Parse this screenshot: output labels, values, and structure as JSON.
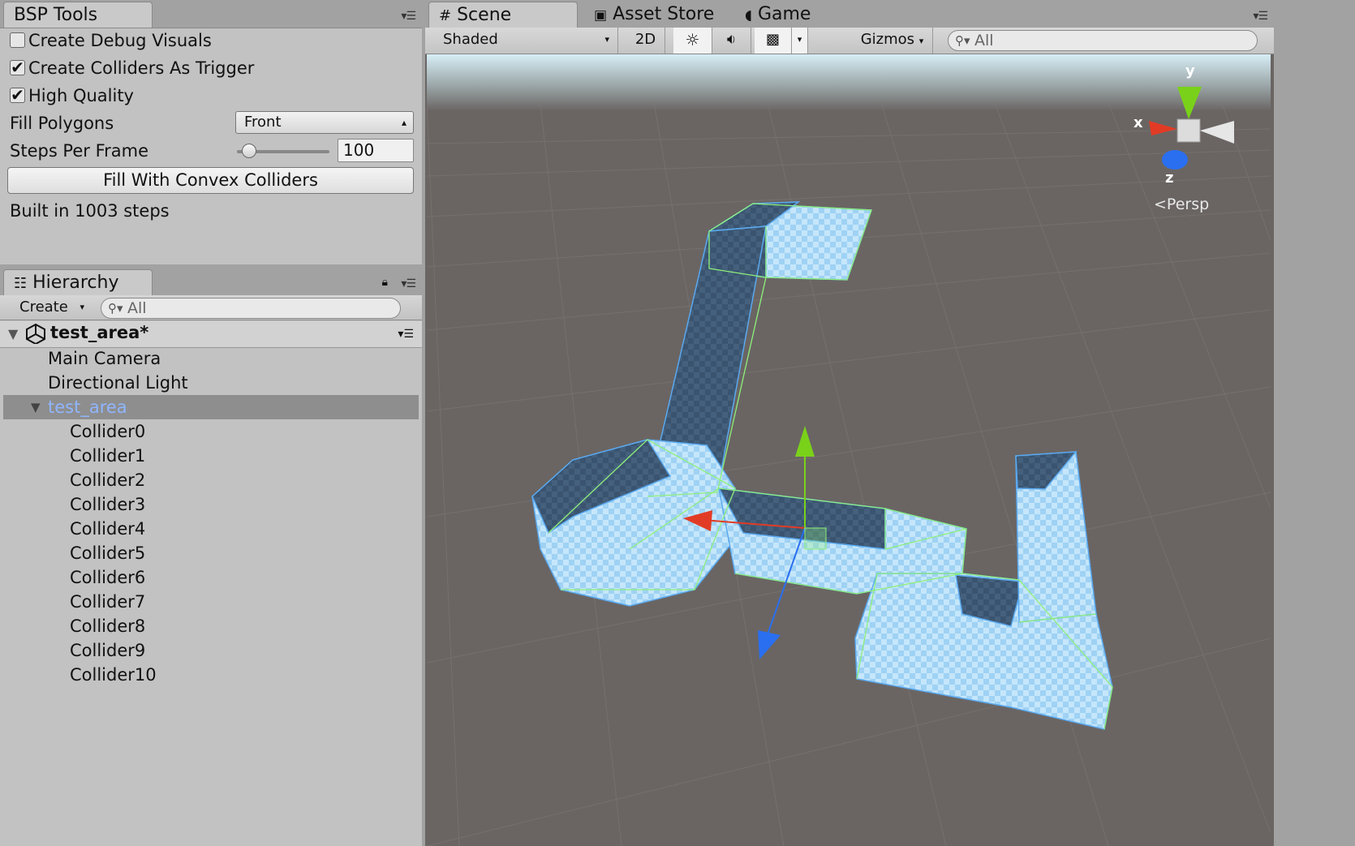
{
  "bsp_tools": {
    "tab_label": "BSP Tools",
    "create_debug_visuals": {
      "label": "Create Debug Visuals",
      "checked": false
    },
    "create_colliders_as_trigger": {
      "label": "Create Colliders As Trigger",
      "checked": true
    },
    "high_quality": {
      "label": "High Quality",
      "checked": true
    },
    "fill_polygons": {
      "label": "Fill Polygons",
      "value": "Front"
    },
    "steps_per_frame": {
      "label": "Steps Per Frame",
      "value": "100"
    },
    "fill_button_label": "Fill With Convex Colliders",
    "status": "Built in 1003 steps"
  },
  "hierarchy": {
    "tab_label": "Hierarchy",
    "create_label": "Create",
    "search_placeholder": "All",
    "scene_name": "test_area*",
    "items": [
      {
        "label": "Main Camera"
      },
      {
        "label": "Directional Light"
      },
      {
        "label": "test_area",
        "selected": true
      },
      {
        "label": "Collider0"
      },
      {
        "label": "Collider1"
      },
      {
        "label": "Collider2"
      },
      {
        "label": "Collider3"
      },
      {
        "label": "Collider4"
      },
      {
        "label": "Collider5"
      },
      {
        "label": "Collider6"
      },
      {
        "label": "Collider7"
      },
      {
        "label": "Collider8"
      },
      {
        "label": "Collider9"
      },
      {
        "label": "Collider10"
      }
    ]
  },
  "scene_view": {
    "tabs": [
      {
        "label": "Scene",
        "icon": "grid-icon",
        "active": true
      },
      {
        "label": "Asset Store",
        "icon": "store-bag-icon",
        "active": false
      },
      {
        "label": "Game",
        "icon": "pacman-icon",
        "active": false
      }
    ],
    "shading_mode": "Shaded",
    "toggle_2d": "2D",
    "gizmos_label": "Gizmos",
    "search_placeholder": "All",
    "gizmo_axes": {
      "x": "x",
      "y": "y",
      "z": "z"
    },
    "projection_label": "Persp"
  },
  "colors": {
    "panel_bg": "#c2c2c2",
    "selection_bg": "#8e8e8e",
    "selected_text": "#8fb5ff",
    "collider_fill": "#a9d6f5",
    "collider_edge": "#5aa9f0",
    "collider_wire": "#8ef07a",
    "axis_x": "#e23b25",
    "axis_y": "#7ad11a",
    "axis_z": "#2a6ff0"
  }
}
